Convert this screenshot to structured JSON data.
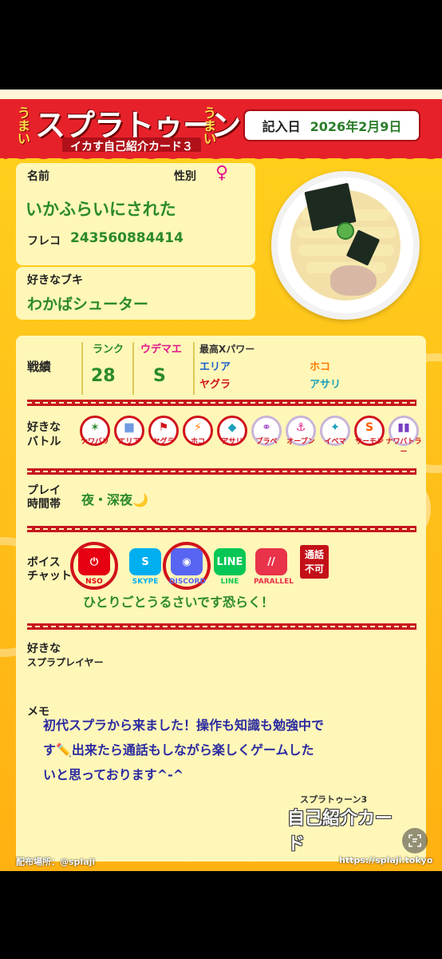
{
  "header": {
    "umai_left": "うまい",
    "umai_right": "うまい",
    "title": "スプラトゥーン",
    "subtitle": "イカす自己紹介カード３",
    "date_label": "記入日",
    "date_value": "2026年2月9日"
  },
  "profile": {
    "name_label": "名前",
    "gender_label": "性別",
    "gender_symbol": "♀",
    "name_value": "いかふらいにされた",
    "friend_code_label": "フレコ",
    "friend_code_value": "243560884414"
  },
  "weapon": {
    "label": "好きなブキ",
    "value": "わかばシューター"
  },
  "record": {
    "label": "戦績",
    "rank_label": "ランク",
    "rank_value": "28",
    "udemae_label": "ウデマエ",
    "udemae_value": "S",
    "xpower_label": "最高Xパワー",
    "modes": [
      "エリア",
      "ホコ",
      "ヤグラ",
      "アサリ"
    ]
  },
  "battle": {
    "label_line1": "好きな",
    "label_line2": "バトル",
    "modes": [
      {
        "name": "ナワバリ",
        "symbol": "✶",
        "selected": true
      },
      {
        "name": "エリア",
        "symbol": "▦",
        "selected": true
      },
      {
        "name": "ヤグラ",
        "symbol": "⚑",
        "selected": true
      },
      {
        "name": "ホコ",
        "symbol": "⚡",
        "selected": true
      },
      {
        "name": "アサリ",
        "symbol": "◆",
        "selected": true
      },
      {
        "name": "プラベ",
        "symbol": "⚭",
        "selected": false
      },
      {
        "name": "オープン",
        "symbol": "⚓",
        "selected": false
      },
      {
        "name": "イベマ",
        "symbol": "✦",
        "selected": false
      },
      {
        "name": "サーモン",
        "symbol": "S",
        "selected": true
      },
      {
        "name": "ナワバトラー",
        "symbol": "▮▮",
        "selected": false
      }
    ]
  },
  "playtime": {
    "label_line1": "プレイ",
    "label_line2": "時間帯",
    "value": "夜・深夜🌙"
  },
  "voice": {
    "label_line1": "ボイス",
    "label_line2": "チャット",
    "apps": [
      {
        "name": "NSO",
        "mark": "⏻",
        "color": "#e60012",
        "selected": true
      },
      {
        "name": "SKYPE",
        "mark": "S",
        "color": "#00aff0",
        "selected": false
      },
      {
        "name": "DISCORD",
        "mark": "◉",
        "color": "#5865f2",
        "selected": true
      },
      {
        "name": "LINE",
        "mark": "LINE",
        "color": "#06c755",
        "selected": false
      },
      {
        "name": "PARALLEL",
        "mark": "//",
        "color": "#e8334a",
        "selected": false
      }
    ],
    "no_call_line1": "通話",
    "no_call_line2": "不可",
    "comment": "ひとりごとうるさいです恐らく！"
  },
  "fav_player": {
    "label_line1": "好きな",
    "label_line2": "スプラプレイヤー"
  },
  "memo": {
    "label": "メモ",
    "line1": "初代スプラから来ました！操作も知識も勉強中で",
    "line2": "す✏️出来たら通話もしながら楽しくゲームした",
    "line3": "いと思っております^-^"
  },
  "footer": {
    "left": "配布場所：@splaji",
    "right": "https://splaji.tokyo",
    "corner_logo_top": "スプラトゥーン3",
    "corner_logo_main": "自己紹介カード"
  },
  "colors": {
    "banner_red": "#e6212a",
    "card_yellow": "#ffc11a",
    "panel": "#fff7b8",
    "green_text": "#2b8a2b",
    "memo_text": "#2a2aa0"
  }
}
